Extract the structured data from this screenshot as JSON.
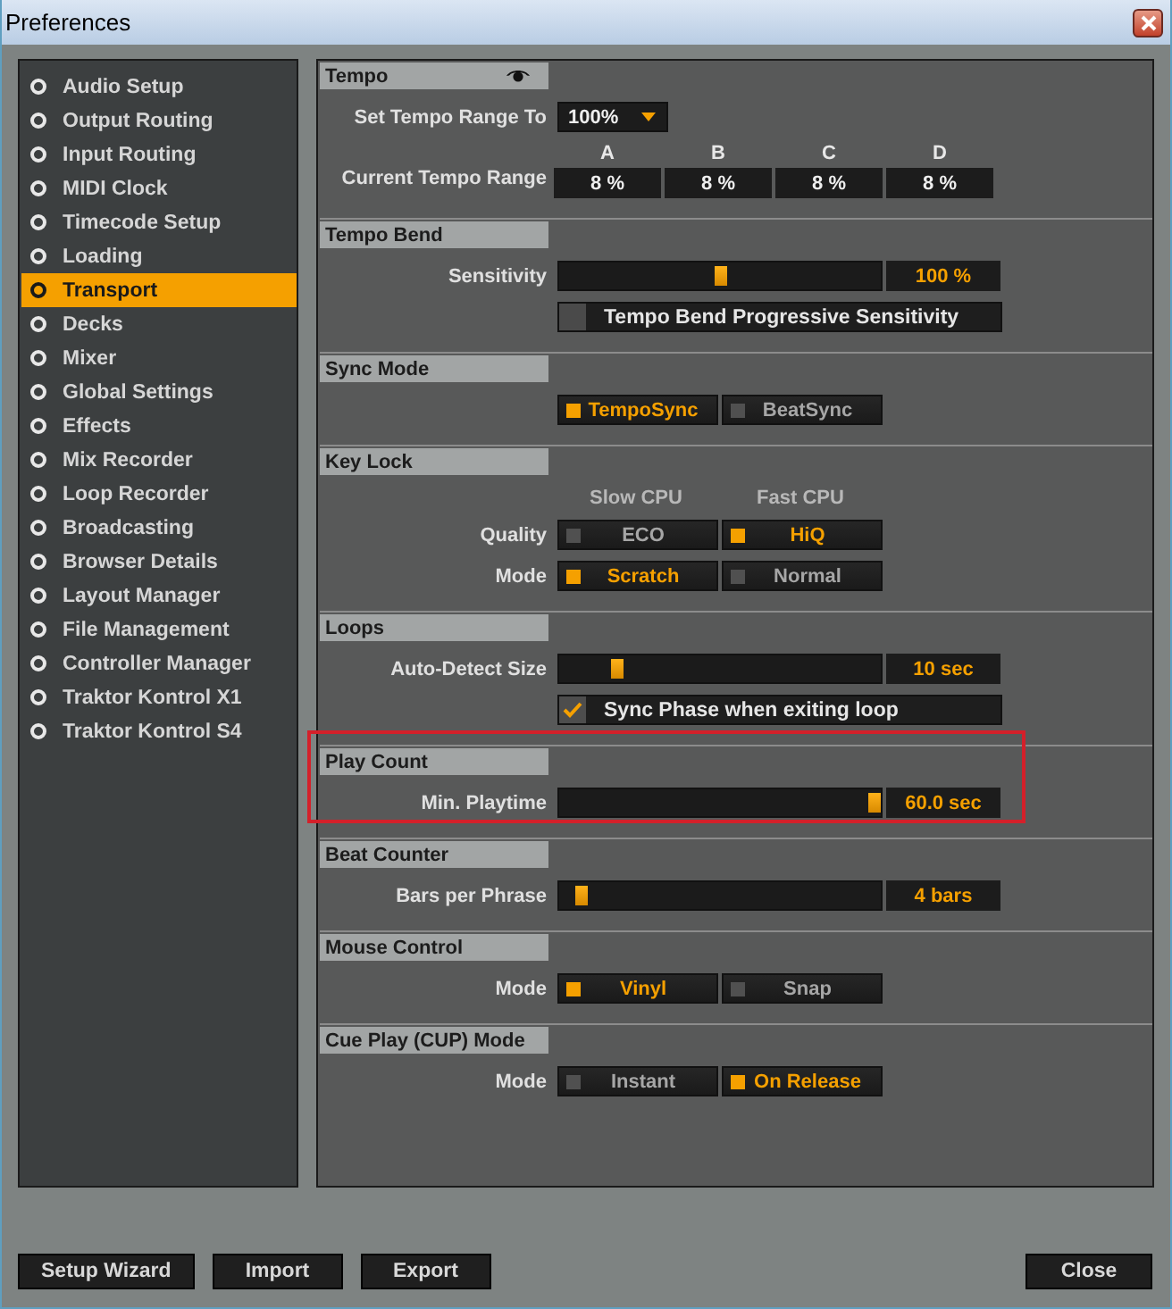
{
  "window": {
    "title": "Preferences"
  },
  "sidebar": {
    "items": [
      {
        "label": "Audio Setup",
        "selected": false
      },
      {
        "label": "Output Routing",
        "selected": false
      },
      {
        "label": "Input Routing",
        "selected": false
      },
      {
        "label": "MIDI Clock",
        "selected": false
      },
      {
        "label": "Timecode Setup",
        "selected": false
      },
      {
        "label": "Loading",
        "selected": false
      },
      {
        "label": "Transport",
        "selected": true
      },
      {
        "label": "Decks",
        "selected": false
      },
      {
        "label": "Mixer",
        "selected": false
      },
      {
        "label": "Global Settings",
        "selected": false
      },
      {
        "label": "Effects",
        "selected": false
      },
      {
        "label": "Mix Recorder",
        "selected": false
      },
      {
        "label": "Loop Recorder",
        "selected": false
      },
      {
        "label": "Broadcasting",
        "selected": false
      },
      {
        "label": "Browser Details",
        "selected": false
      },
      {
        "label": "Layout Manager",
        "selected": false
      },
      {
        "label": "File Management",
        "selected": false
      },
      {
        "label": "Controller Manager",
        "selected": false
      },
      {
        "label": "Traktor Kontrol X1",
        "selected": false
      },
      {
        "label": "Traktor Kontrol S4",
        "selected": false
      }
    ]
  },
  "sections": [
    {
      "title": "Tempo",
      "show_icon": true,
      "highlighted": false,
      "rows": [
        {
          "kind": "dropdown",
          "label": "Set Tempo Range To",
          "value": "100%"
        },
        {
          "kind": "grid",
          "label": "Current Tempo Range",
          "columns": [
            {
              "header": "A",
              "value": "8 %"
            },
            {
              "header": "B",
              "value": "8 %"
            },
            {
              "header": "C",
              "value": "8 %"
            },
            {
              "header": "D",
              "value": "8 %"
            }
          ]
        }
      ]
    },
    {
      "title": "Tempo Bend",
      "show_icon": false,
      "highlighted": false,
      "rows": [
        {
          "kind": "slider",
          "label": "Sensitivity",
          "level": 0.5,
          "reading": "100 %"
        },
        {
          "kind": "checkbox",
          "text": "Tempo Bend Progressive Sensitivity",
          "checked": false
        }
      ]
    },
    {
      "title": "Sync Mode",
      "show_icon": false,
      "highlighted": false,
      "rows": [
        {
          "kind": "options",
          "options": [
            {
              "text": "TempoSync",
              "selected": true
            },
            {
              "text": "BeatSync",
              "selected": false
            }
          ]
        }
      ]
    },
    {
      "title": "Key Lock",
      "show_icon": false,
      "highlighted": false,
      "rows": [
        {
          "kind": "captions",
          "captions": [
            "Slow CPU",
            "Fast CPU"
          ]
        },
        {
          "kind": "options",
          "label": "Quality",
          "options": [
            {
              "text": "ECO",
              "selected": false
            },
            {
              "text": "HiQ",
              "selected": true
            }
          ]
        },
        {
          "kind": "options",
          "label": "Mode",
          "options": [
            {
              "text": "Scratch",
              "selected": true
            },
            {
              "text": "Normal",
              "selected": false
            }
          ]
        }
      ]
    },
    {
      "title": "Loops",
      "show_icon": false,
      "highlighted": false,
      "rows": [
        {
          "kind": "slider",
          "label": "Auto-Detect Size",
          "level": 0.17,
          "reading": "10 sec"
        },
        {
          "kind": "checkbox",
          "text": "Sync Phase when exiting loop",
          "checked": true
        }
      ]
    },
    {
      "title": "Play Count",
      "show_icon": false,
      "highlighted": true,
      "rows": [
        {
          "kind": "slider",
          "label": "Min. Playtime",
          "level": 1,
          "reading": "60.0 sec"
        }
      ]
    },
    {
      "title": "Beat Counter",
      "show_icon": false,
      "highlighted": false,
      "rows": [
        {
          "kind": "slider",
          "label": "Bars per Phrase",
          "level": 0.05,
          "reading": "4 bars"
        }
      ]
    },
    {
      "title": "Mouse Control",
      "show_icon": false,
      "highlighted": false,
      "rows": [
        {
          "kind": "options",
          "label": "Mode",
          "options": [
            {
              "text": "Vinyl",
              "selected": true
            },
            {
              "text": "Snap",
              "selected": false
            }
          ]
        }
      ]
    },
    {
      "title": "Cue Play (CUP) Mode",
      "show_icon": false,
      "highlighted": false,
      "rows": [
        {
          "kind": "options",
          "label": "Mode",
          "options": [
            {
              "text": "Instant",
              "selected": false
            },
            {
              "text": "On Release",
              "selected": true
            }
          ]
        }
      ]
    }
  ],
  "footer": {
    "left_buttons": [
      "Setup Wizard",
      "Import",
      "Export"
    ],
    "right_buttons": [
      "Close"
    ]
  }
}
